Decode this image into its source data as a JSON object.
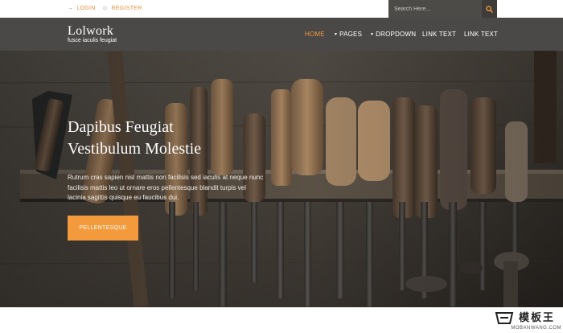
{
  "topbar": {
    "login_label": "LOGIN",
    "register_label": "REGISTER",
    "search_placeholder": "Search Here...",
    "search_icon": "search-icon"
  },
  "nav": {
    "brand": "Lolwork",
    "tagline": "fusce iaculis feugiat",
    "items": [
      {
        "label": "HOME",
        "active": true
      },
      {
        "label": "PAGES",
        "dropdown": true
      },
      {
        "label": "DROPDOWN",
        "dropdown": true
      },
      {
        "label": "LINK TEXT"
      },
      {
        "label": "LINK TEXT"
      }
    ]
  },
  "hero": {
    "title_line1": "Dapibus Feugiat",
    "title_line2": "Vestibulum Molestie",
    "text_line1": "Rutrum cras sapien nisl mattis non facilisis sed iaculis at neque nunc",
    "text_line2": "facilisis mattis leo ut ornare eros pellentesque blandit turpis vel",
    "text_line3": "lacinia sagittis quisque eu faucibus dui.",
    "cta_label": "PELLENTESQUE"
  },
  "watermark": {
    "cn": "模板王",
    "en": "MOBANWANG.COM"
  },
  "colors": {
    "accent": "#f39a3c",
    "navbar": "#4b4947",
    "search_bg": "#4d4b48"
  }
}
